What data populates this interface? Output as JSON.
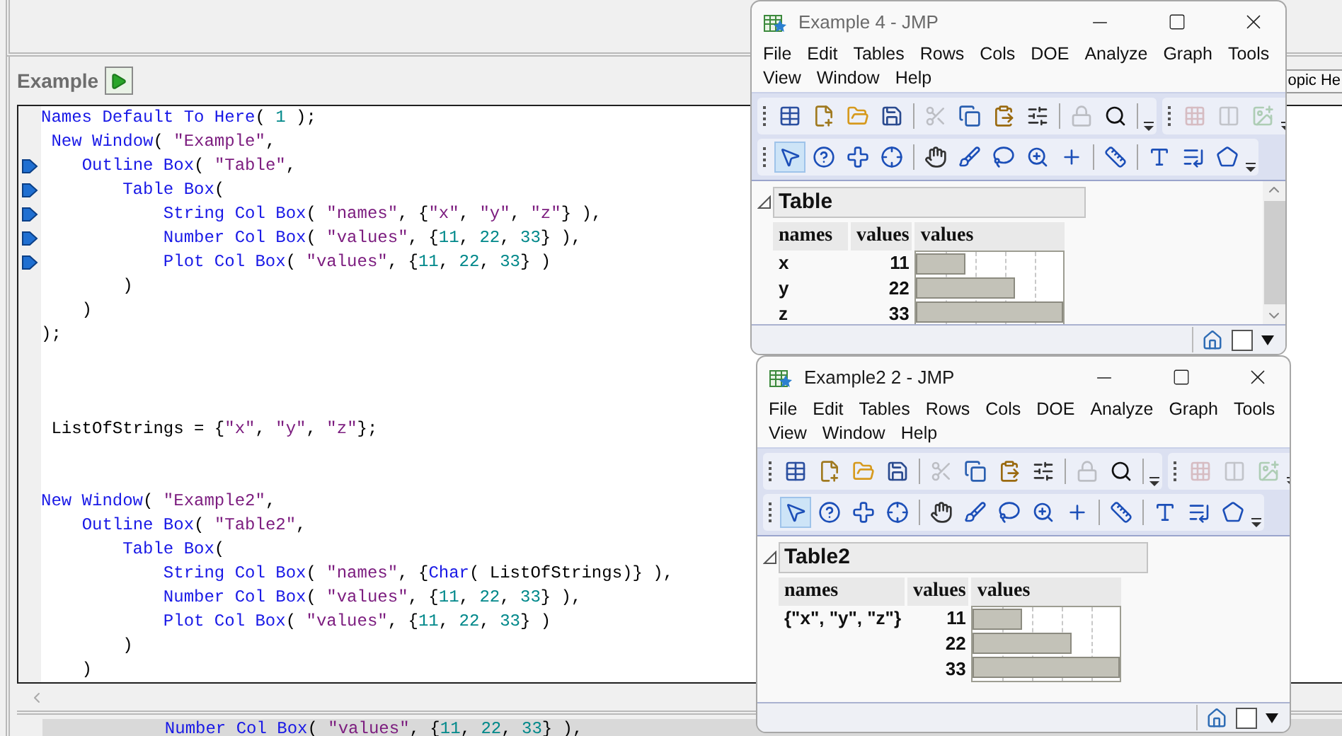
{
  "editor": {
    "title": "Example",
    "help_tab": "opic He",
    "lines": [
      {
        "kind": "code",
        "text": "Names Default To Here( 1 );",
        "marker": false
      },
      {
        "kind": "code",
        "text": " New Window( \"Example\",",
        "marker": false
      },
      {
        "kind": "code",
        "text": "    Outline Box( \"Table\",",
        "marker": true
      },
      {
        "kind": "code",
        "text": "        Table Box(",
        "marker": true
      },
      {
        "kind": "code",
        "text": "            String Col Box( \"names\", {\"x\", \"y\", \"z\"} ),",
        "marker": true
      },
      {
        "kind": "code",
        "text": "            Number Col Box( \"values\", {11, 22, 33} ),",
        "marker": true
      },
      {
        "kind": "code",
        "text": "            Plot Col Box( \"values\", {11, 22, 33} )",
        "marker": true
      },
      {
        "kind": "code",
        "text": "        )",
        "marker": false
      },
      {
        "kind": "code",
        "text": "    )",
        "marker": false
      },
      {
        "kind": "code",
        "text": ");",
        "marker": false
      },
      {
        "kind": "blank"
      },
      {
        "kind": "blank"
      },
      {
        "kind": "blank"
      },
      {
        "kind": "code",
        "text": " ListOfStrings = {\"x\", \"y\", \"z\"};",
        "marker": false
      },
      {
        "kind": "blank"
      },
      {
        "kind": "blank"
      },
      {
        "kind": "code",
        "text": "New Window( \"Example2\",",
        "marker": false
      },
      {
        "kind": "code",
        "text": "    Outline Box( \"Table2\",",
        "marker": false
      },
      {
        "kind": "code",
        "text": "        Table Box(",
        "marker": false
      },
      {
        "kind": "code",
        "text": "            String Col Box( \"names\", {Char( ListOfStrings)} ),",
        "marker": false
      },
      {
        "kind": "code",
        "text": "            Number Col Box( \"values\", {11, 22, 33} ),",
        "marker": false
      },
      {
        "kind": "code",
        "text": "            Plot Col Box( \"values\", {11, 22, 33} )",
        "marker": false
      },
      {
        "kind": "code",
        "text": "        )",
        "marker": false
      },
      {
        "kind": "code",
        "text": "    )",
        "marker": false
      }
    ],
    "bottom_line": "            Number Col Box( \"values\", {11, 22, 33} ),"
  },
  "windows": [
    {
      "title": "Example 4 - JMP",
      "active": false,
      "scrollbar": true,
      "menu": [
        "File",
        "Edit",
        "Tables",
        "Rows",
        "Cols",
        "DOE",
        "Analyze",
        "Graph",
        "Tools",
        "View",
        "Window",
        "Help"
      ],
      "toolbar_1": [
        {
          "disabled": false
        },
        {
          "disabled": false
        },
        {
          "disabled": false
        },
        {
          "disabled": false
        },
        {
          "disabled": true
        },
        {
          "disabled": false
        },
        {
          "disabled": false
        },
        {
          "disabled": false
        },
        {
          "disabled": true
        },
        {
          "disabled": false
        },
        {
          "disabled": true
        },
        {
          "disabled": true
        },
        {
          "disabled": true
        }
      ],
      "toolbar_2": [
        {
          "selected": true
        },
        {
          "selected": false
        },
        {
          "selected": false
        },
        {
          "selected": false
        },
        {
          "selected": false
        },
        {
          "selected": false
        },
        {
          "selected": false
        },
        {
          "selected": false
        },
        {
          "selected": false
        },
        {
          "selected": false
        },
        {
          "selected": false
        },
        {
          "selected": false
        },
        {
          "selected": false
        }
      ],
      "outline": {
        "title": "Table",
        "expanded": true
      },
      "columns": [
        "names",
        "values",
        "values"
      ],
      "rows": [
        {
          "name": "x",
          "value": "11",
          "level": 0.33
        },
        {
          "name": "y",
          "value": "22",
          "level": 0.67
        },
        {
          "name": "z",
          "value": "33",
          "level": 1
        }
      ]
    },
    {
      "title": "Example2 2 - JMP",
      "active": true,
      "scrollbar": false,
      "menu": [
        "File",
        "Edit",
        "Tables",
        "Rows",
        "Cols",
        "DOE",
        "Analyze",
        "Graph",
        "Tools",
        "View",
        "Window",
        "Help"
      ],
      "toolbar_1": [
        {
          "disabled": false
        },
        {
          "disabled": false
        },
        {
          "disabled": false
        },
        {
          "disabled": false
        },
        {
          "disabled": true
        },
        {
          "disabled": false
        },
        {
          "disabled": false
        },
        {
          "disabled": false
        },
        {
          "disabled": true
        },
        {
          "disabled": false
        },
        {
          "disabled": true
        },
        {
          "disabled": true
        },
        {
          "disabled": true
        }
      ],
      "toolbar_2": [
        {
          "selected": true
        },
        {
          "selected": false
        },
        {
          "selected": false
        },
        {
          "selected": false
        },
        {
          "selected": false
        },
        {
          "selected": false
        },
        {
          "selected": false
        },
        {
          "selected": false
        },
        {
          "selected": false
        },
        {
          "selected": false
        },
        {
          "selected": false
        },
        {
          "selected": false
        },
        {
          "selected": false
        }
      ],
      "outline": {
        "title": "Table2",
        "expanded": true
      },
      "columns": [
        "names",
        "values",
        "values"
      ],
      "rows": [
        {
          "name": "{\"x\", \"y\", \"z\"}",
          "value": "11",
          "level": 0.33
        },
        {
          "value": "22",
          "level": 0.67
        },
        {
          "value": "33",
          "level": 1
        }
      ]
    }
  ]
}
